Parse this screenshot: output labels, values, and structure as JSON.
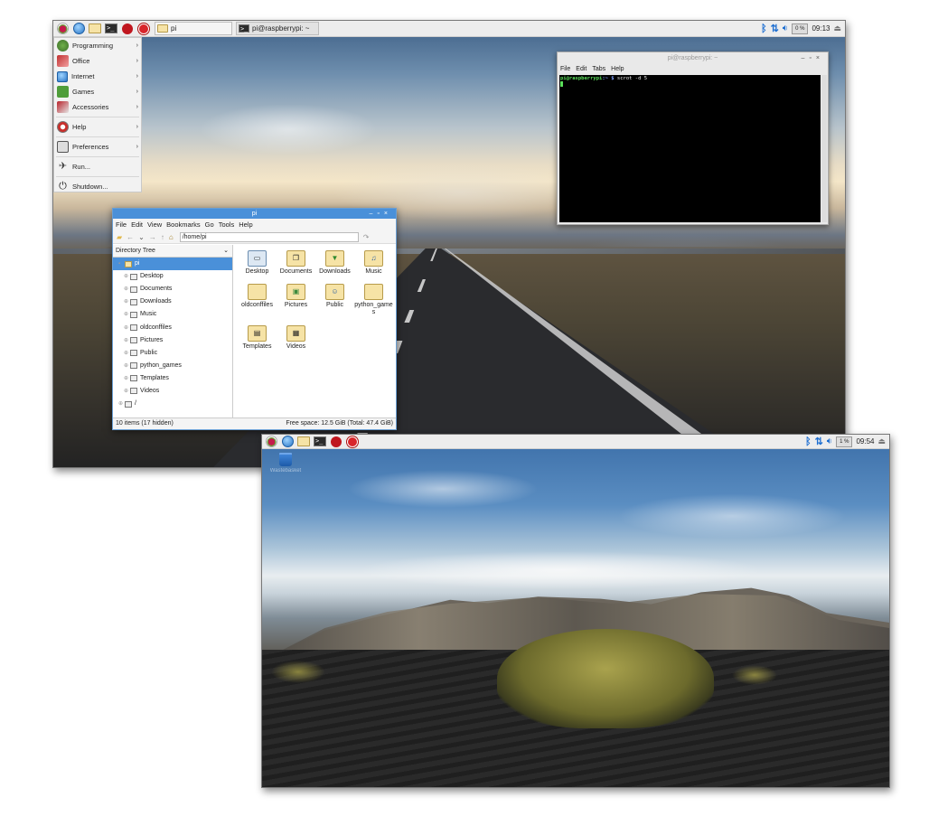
{
  "screen1": {
    "taskbar": {
      "launchers": [
        "raspberry-menu-icon",
        "globe-icon",
        "folder-icon",
        "terminal-icon",
        "bug-icon",
        "mathematica-icon"
      ],
      "tasks": [
        {
          "label": "pi"
        },
        {
          "label": "pi@raspberrypi: ~"
        }
      ],
      "cpu": "0 %",
      "clock": "09:13"
    },
    "menu": {
      "items": [
        {
          "label": "Programming",
          "has_submenu": true,
          "icon": "programming-icon"
        },
        {
          "label": "Office",
          "has_submenu": true,
          "icon": "office-icon"
        },
        {
          "label": "Internet",
          "has_submenu": true,
          "icon": "internet-icon"
        },
        {
          "label": "Games",
          "has_submenu": true,
          "icon": "games-icon"
        },
        {
          "label": "Accessories",
          "has_submenu": true,
          "icon": "accessories-icon"
        },
        {
          "label": "Help",
          "has_submenu": true,
          "icon": "help-icon"
        },
        {
          "label": "Preferences",
          "has_submenu": true,
          "icon": "preferences-icon"
        },
        {
          "label": "Run...",
          "has_submenu": false,
          "icon": "run-icon"
        },
        {
          "label": "Shutdown...",
          "has_submenu": false,
          "icon": "shutdown-icon"
        }
      ]
    },
    "terminal": {
      "title": "pi@raspberrypi: ~",
      "menu": [
        "File",
        "Edit",
        "Tabs",
        "Help"
      ],
      "prompt_user": "pi@raspberrypi",
      "prompt_path": ":~ $",
      "command": "scrot -d 5"
    },
    "file_manager": {
      "title": "pi",
      "menu": [
        "File",
        "Edit",
        "View",
        "Bookmarks",
        "Go",
        "Tools",
        "Help"
      ],
      "path": "/home/pi",
      "sidebar_header": "Directory Tree",
      "tree": [
        {
          "label": "pi",
          "selected": true,
          "child": false
        },
        {
          "label": "Desktop",
          "child": true
        },
        {
          "label": "Documents",
          "child": true
        },
        {
          "label": "Downloads",
          "child": true
        },
        {
          "label": "Music",
          "child": true
        },
        {
          "label": "oldconffiles",
          "child": true
        },
        {
          "label": "Pictures",
          "child": true
        },
        {
          "label": "Public",
          "child": true
        },
        {
          "label": "python_games",
          "child": true
        },
        {
          "label": "Templates",
          "child": true
        },
        {
          "label": "Videos",
          "child": true
        },
        {
          "label": "/",
          "child": false
        }
      ],
      "files": [
        "Desktop",
        "Documents",
        "Downloads",
        "Music",
        "oldconffiles",
        "Pictures",
        "Public",
        "python_games",
        "Templates",
        "Videos"
      ],
      "status_left": "10 items (17 hidden)",
      "status_right": "Free space: 12.5 GiB (Total: 47.4 GiB)"
    }
  },
  "screen2": {
    "taskbar": {
      "launchers": [
        "raspberry-menu-icon",
        "globe-icon",
        "folder-icon",
        "terminal-icon",
        "bug-icon",
        "mathematica-icon"
      ],
      "cpu": "1 %",
      "clock": "09:54"
    },
    "desktop_icons": [
      {
        "label": "Wastebasket",
        "icon": "trash-icon"
      }
    ]
  },
  "colors": {
    "accent": "#4a90d9",
    "panel": "#ededed",
    "terminal_bg": "#000000",
    "prompt_green": "#5adf5a"
  }
}
